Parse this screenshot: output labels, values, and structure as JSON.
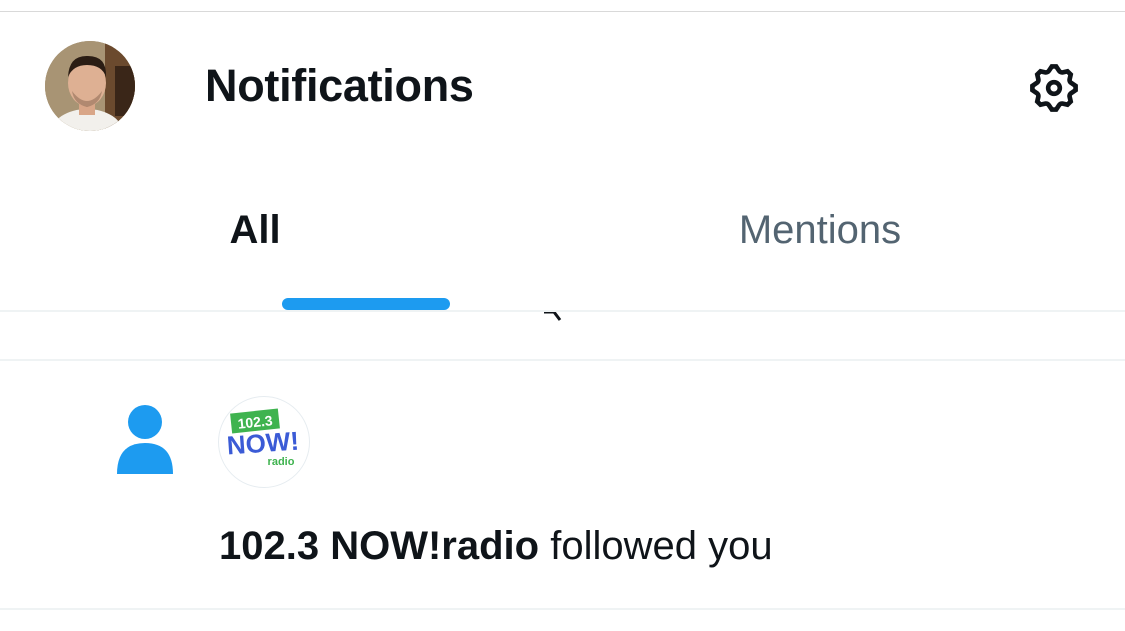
{
  "header": {
    "title": "Notifications",
    "avatar_icon": "profile-photo",
    "settings_icon": "gear-icon"
  },
  "tabs": [
    {
      "label": "All",
      "active": true
    },
    {
      "label": "Mentions",
      "active": false
    }
  ],
  "colors": {
    "accent": "#1d9bf0",
    "text_primary": "#0f1419",
    "text_secondary": "#536471",
    "divider": "#eff3f4"
  },
  "notifications": [
    {
      "type": "follow",
      "icon": "person-icon",
      "account_name": "102.3 NOW!radio",
      "action_text": "followed you",
      "logo": {
        "top": "102.3",
        "middle": "NOW!",
        "bottom": "radio"
      }
    }
  ]
}
